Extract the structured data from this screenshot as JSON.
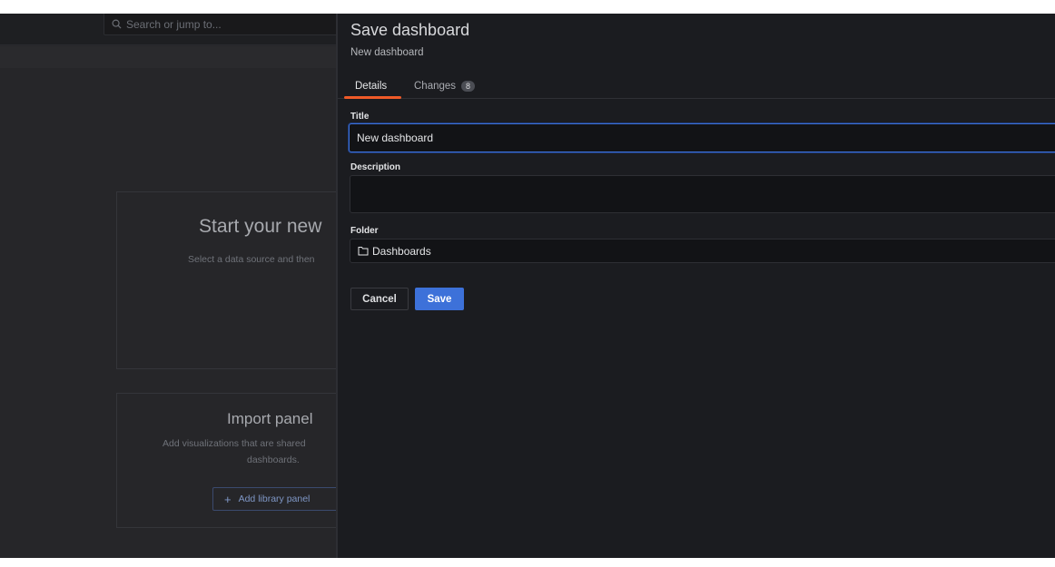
{
  "background": {
    "search_placeholder": "Search or jump to...",
    "start_card": {
      "title": "Start your new",
      "subtitle": "Select a data source and then"
    },
    "import_card": {
      "title": "Import panel",
      "subtitle_line1": "Add visualizations that are shared",
      "subtitle_line2": "dashboards.",
      "button_label": "Add library panel"
    }
  },
  "drawer": {
    "title": "Save dashboard",
    "subtitle": "New dashboard",
    "tabs": [
      {
        "label": "Details",
        "active": true
      },
      {
        "label": "Changes",
        "count": "8",
        "active": false
      }
    ],
    "form": {
      "title_label": "Title",
      "title_value": "New dashboard",
      "description_label": "Description",
      "description_value": "",
      "folder_label": "Folder",
      "folder_value": "Dashboards"
    },
    "actions": {
      "cancel_label": "Cancel",
      "save_label": "Save"
    }
  },
  "icons": {
    "search": "search-icon",
    "folder": "folder-icon",
    "plus": "plus-icon"
  },
  "colors": {
    "accent": "#3d71d9",
    "active_tab": "#f05a28",
    "drawer_bg": "#1b1c20",
    "input_bg": "#121316"
  }
}
